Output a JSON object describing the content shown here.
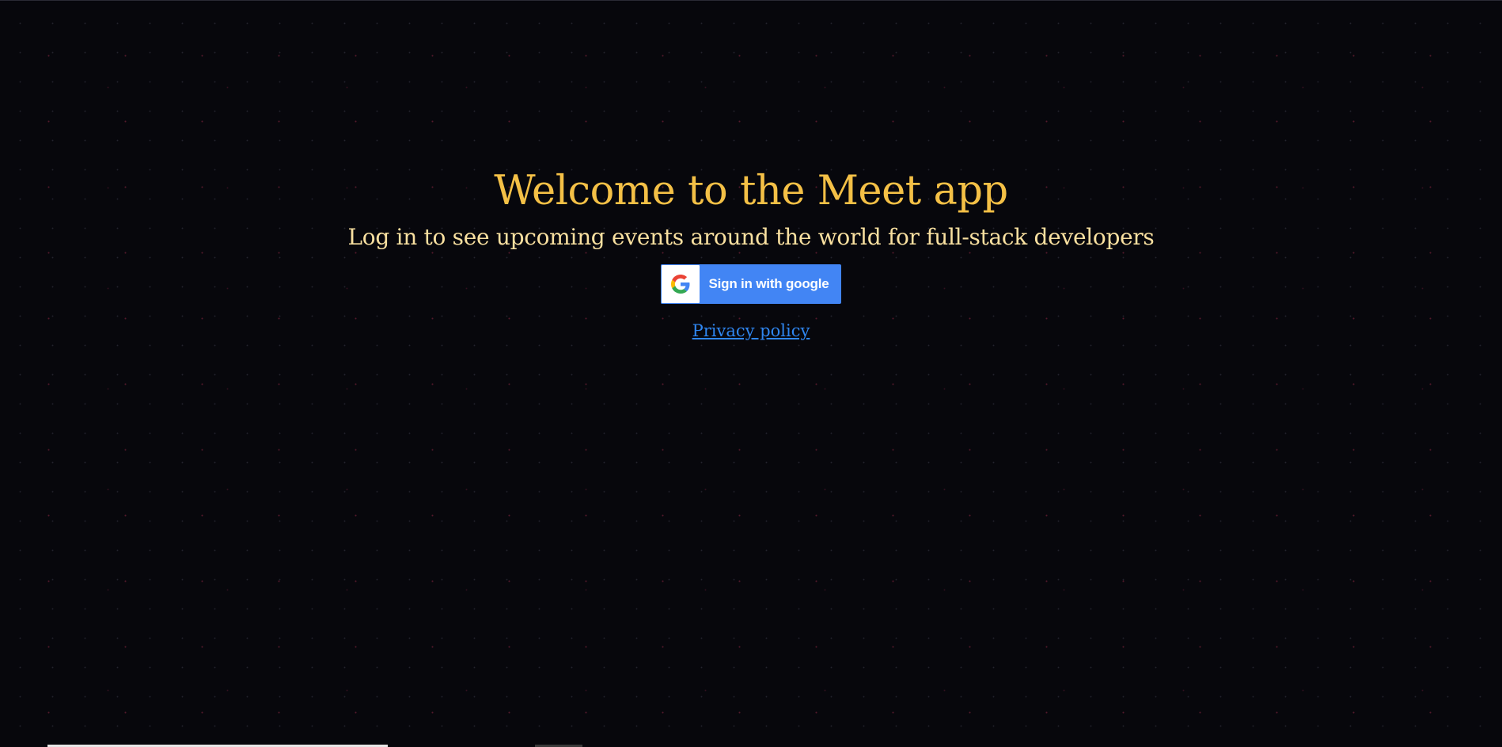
{
  "login": {
    "title": "Welcome to the Meet app",
    "subtitle": "Log in to see upcoming events around the world for full-stack developers",
    "google_button": {
      "label": "Sign in with google",
      "icon": "google-g-logo-icon"
    },
    "privacy_link": "Privacy policy"
  },
  "colors": {
    "background": "#07070c",
    "title": "#f4c046",
    "subtitle": "#f9e0a0",
    "google_blue": "#4285f4",
    "link": "#2f86f0"
  }
}
